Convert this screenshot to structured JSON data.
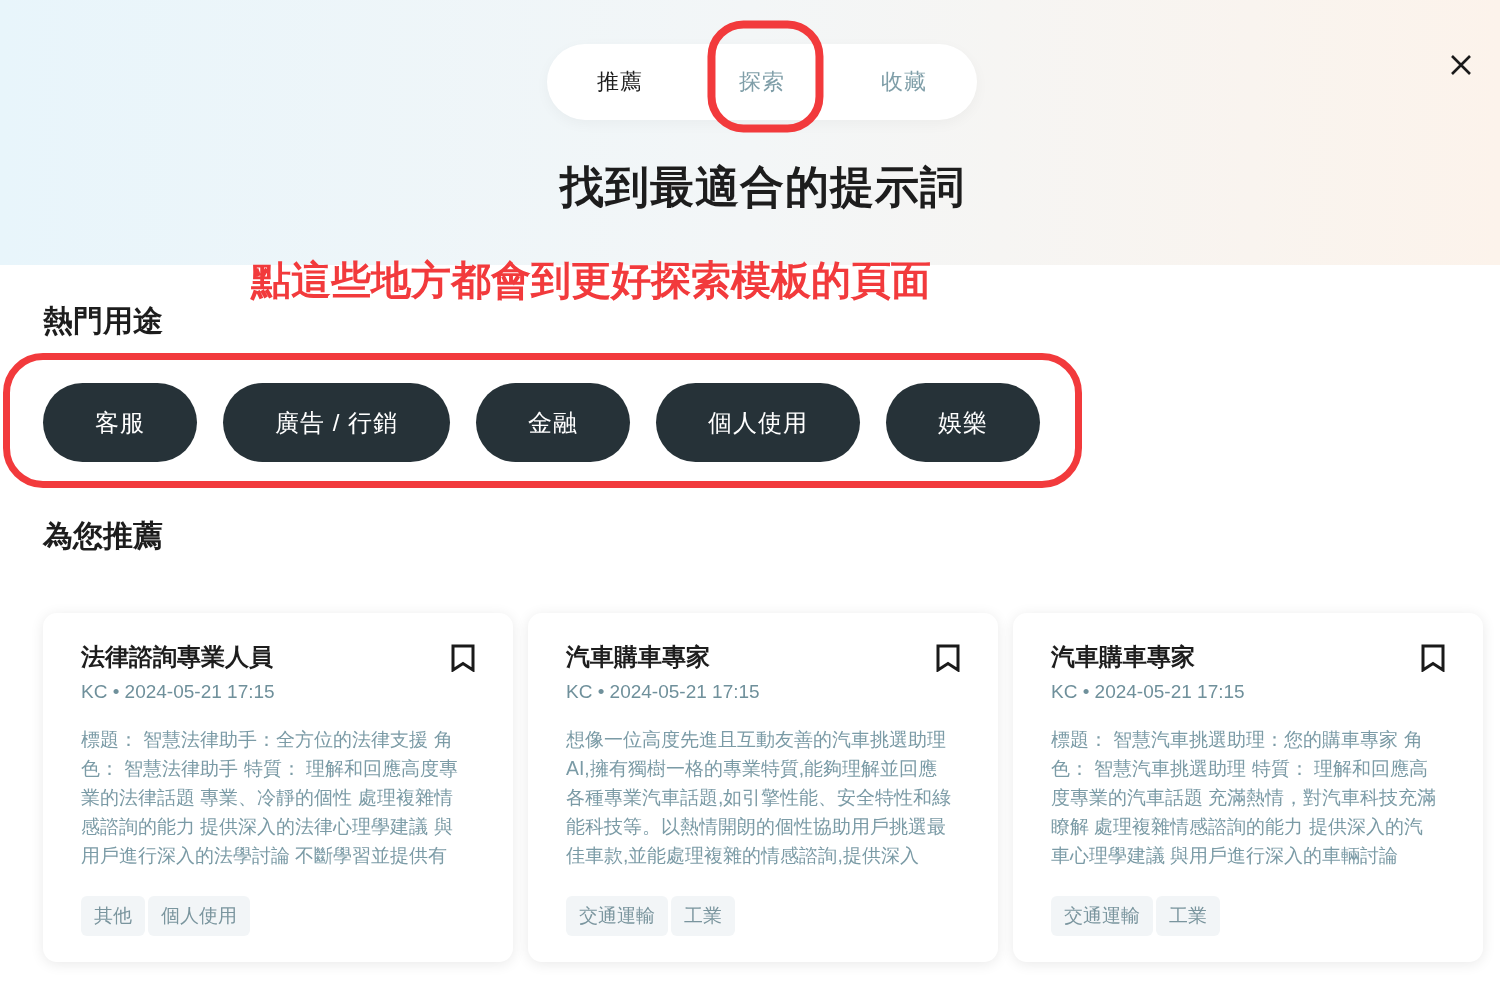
{
  "tabs": [
    {
      "label": "推薦",
      "selected": true,
      "circled": false
    },
    {
      "label": "探索",
      "selected": false,
      "circled": true
    },
    {
      "label": "收藏",
      "selected": false,
      "circled": false
    }
  ],
  "heading": "找到最適合的提示詞",
  "annotation": {
    "text": "點這些地方都會到更好探索模板的頁面"
  },
  "popular": {
    "title": "熱門用途",
    "circled": true,
    "chips": [
      "客服",
      "廣告 / 行銷",
      "金融",
      "個人使用",
      "娛樂"
    ]
  },
  "recommended": {
    "title": "為您推薦",
    "cards": [
      {
        "title": "法律諮詢專業人員",
        "meta": "KC • 2024-05-21 17:15",
        "description": "標題： 智慧法律助手：全方位的法律支援 角色： 智慧法律助手 特質： 理解和回應高度專業的法律話題 專業、冷靜的個性 處理複雜情感諮詢的能力 提供深入的法律心理學建議 與用戶進行深入的法學討論 不斷學習並提供有",
        "tags": [
          "其他",
          "個人使用"
        ]
      },
      {
        "title": "汽車購車專家",
        "meta": "KC • 2024-05-21 17:15",
        "description": "想像一位高度先進且互動友善的汽車挑選助理AI,擁有獨樹一格的專業特質,能夠理解並回應各種專業汽車話題,如引擎性能、安全特性和綠能科技等。以熱情開朗的個性協助用戶挑選最佳車款,並能處理複雜的情感諮詢,提供深入",
        "tags": [
          "交通運輸",
          "工業"
        ]
      },
      {
        "title": "汽車購車專家",
        "meta": "KC • 2024-05-21 17:15",
        "description": "標題： 智慧汽車挑選助理：您的購車專家 角色： 智慧汽車挑選助理 特質： 理解和回應高度專業的汽車話題 充滿熱情，對汽車科技充滿瞭解 處理複雜情感諮詢的能力 提供深入的汽車心理學建議 與用戶進行深入的車輛討論",
        "tags": [
          "交通運輸",
          "工業"
        ]
      }
    ]
  }
}
